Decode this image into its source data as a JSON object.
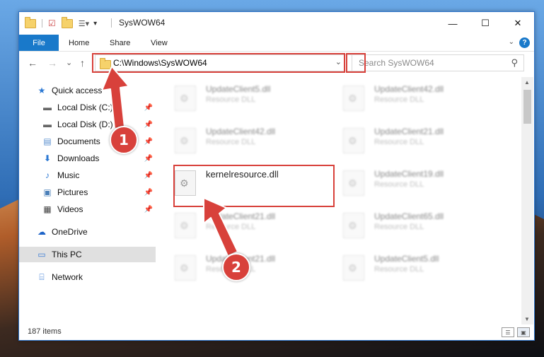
{
  "window": {
    "title": "SysWOW64",
    "minimize": "—",
    "maximize": "☐",
    "close": "✕"
  },
  "ribbon": {
    "file": "File",
    "home": "Home",
    "share": "Share",
    "view": "View",
    "help": "?"
  },
  "nav": {
    "back": "←",
    "forward": "→",
    "recent": "⌄",
    "up": "↑",
    "address": "C:\\Windows\\SysWOW64",
    "search_placeholder": "Search SysWOW64"
  },
  "sidebar": {
    "items": [
      {
        "label": "Quick access",
        "icon": "star-icon"
      },
      {
        "label": "Local Disk (C:)",
        "icon": "drive-icon"
      },
      {
        "label": "Local Disk (D:)",
        "icon": "drive-icon"
      },
      {
        "label": "Documents",
        "icon": "documents-icon"
      },
      {
        "label": "Downloads",
        "icon": "download-icon"
      },
      {
        "label": "Music",
        "icon": "music-icon"
      },
      {
        "label": "Pictures",
        "icon": "pictures-icon"
      },
      {
        "label": "Videos",
        "icon": "videos-icon"
      },
      {
        "label": "OneDrive",
        "icon": "cloud-icon"
      },
      {
        "label": "This PC",
        "icon": "computer-icon"
      },
      {
        "label": "Network",
        "icon": "network-icon"
      }
    ]
  },
  "files": [
    {
      "name": "UpdateClient5.dll",
      "type": "Resource DLL"
    },
    {
      "name": "UpdateClient42.dll",
      "type": "Resource DLL"
    },
    {
      "name": "UpdateClient42.dll",
      "type": "Resource DLL"
    },
    {
      "name": "UpdateClient21.dll",
      "type": "Resource DLL"
    },
    {
      "name": "kernelresource.dll",
      "type": ""
    },
    {
      "name": "UpdateClient19.dll",
      "type": "Resource DLL"
    },
    {
      "name": "UpdateClient21.dll",
      "type": "Resource DLL"
    },
    {
      "name": "UpdateClient65.dll",
      "type": "Resource DLL"
    },
    {
      "name": "UpdateClient21.dll",
      "type": "Resource DLL"
    },
    {
      "name": "UpdateClient5.dll",
      "type": "Resource DLL"
    }
  ],
  "status": {
    "item_count": "187 items"
  },
  "annotations": {
    "step1": "1",
    "step2": "2",
    "color": "#d8413b"
  }
}
